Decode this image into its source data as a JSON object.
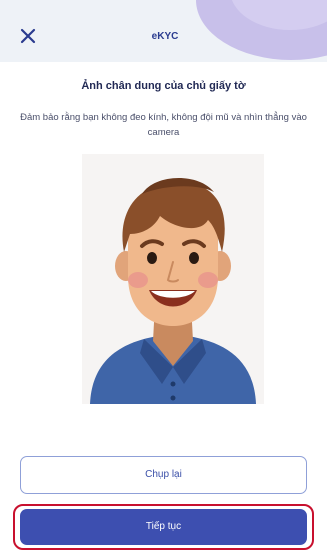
{
  "header": {
    "title": "eKYC",
    "close_icon": "close-icon"
  },
  "content": {
    "title": "Ảnh chân dung của chủ giấy tờ",
    "instruction": "Đảm bảo rằng bạn không đeo kính, không đội mũ và nhìn thẳng vào camera"
  },
  "portrait": {
    "icon": "person-portrait-illustration"
  },
  "buttons": {
    "retake_label": "Chụp lại",
    "continue_label": "Tiếp tục"
  },
  "colors": {
    "primary": "#3d4fb0",
    "highlight_border": "#c8102e",
    "header_bg": "#eef2f7",
    "header_decor": "#c8c0ea"
  }
}
